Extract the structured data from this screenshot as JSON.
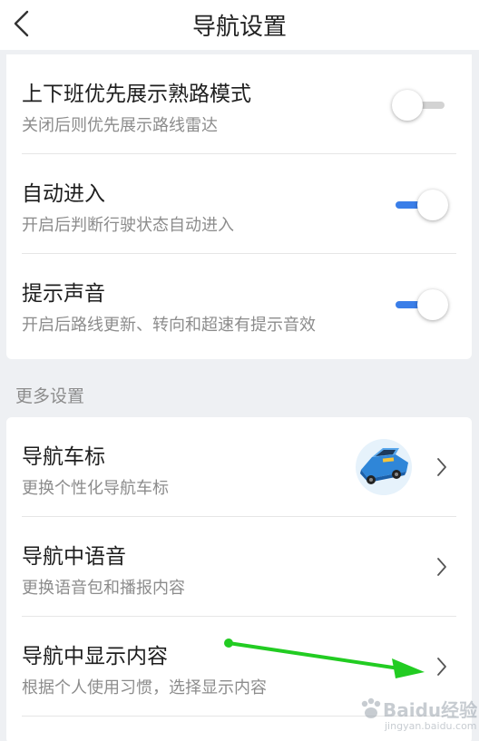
{
  "header": {
    "title": "导航设置",
    "back_icon": "chevron-left-icon"
  },
  "card1": {
    "rows": [
      {
        "title": "上下班优先展示熟路模式",
        "subtitle": "关闭后则优先展示路线雷达",
        "toggle": "off"
      },
      {
        "title": "自动进入",
        "subtitle": "开启后判断行驶状态自动进入",
        "toggle": "on"
      },
      {
        "title": "提示声音",
        "subtitle": "开启后路线更新、转向和超速有提示音效",
        "toggle": "on"
      }
    ]
  },
  "section": {
    "label": "更多设置"
  },
  "card2": {
    "rows": [
      {
        "title": "导航车标",
        "subtitle": "更换个性化导航车标",
        "icon": "car-icon"
      },
      {
        "title": "导航中语音",
        "subtitle": "更换语音包和播报内容"
      },
      {
        "title": "导航中显示内容",
        "subtitle": "根据个人使用习惯，选择显示内容"
      }
    ]
  },
  "colors": {
    "accent": "#3a7ee8",
    "annotation_arrow": "#22cc22"
  },
  "watermark": {
    "brand": "Baidu经验",
    "url": "jingyan.baidu.com"
  }
}
